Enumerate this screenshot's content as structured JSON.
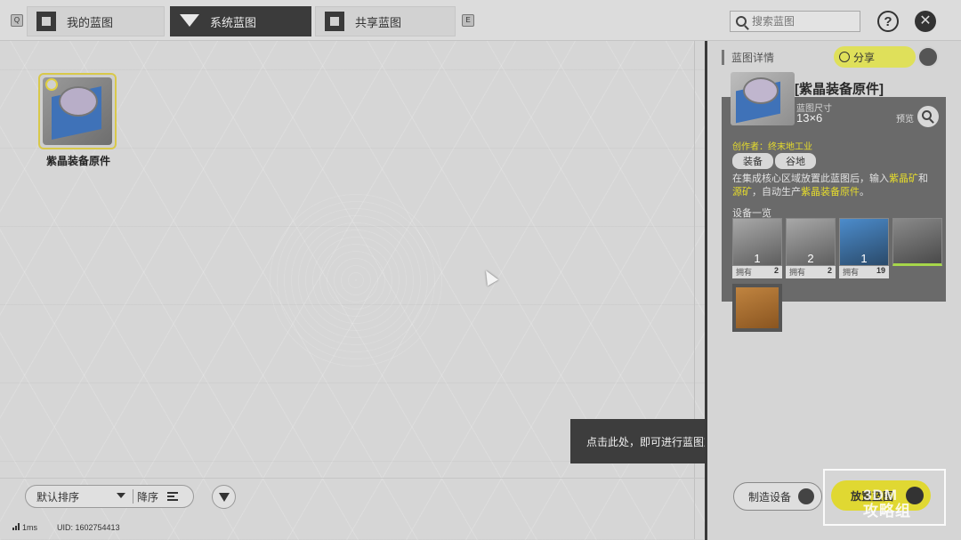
{
  "topbar": {
    "key_left": "Q",
    "key_right": "E",
    "tabs": [
      {
        "label": "我的蓝图",
        "active": false
      },
      {
        "label": "系统蓝图",
        "active": true
      },
      {
        "label": "共享蓝图",
        "active": false
      }
    ],
    "search_placeholder": "搜索蓝图",
    "help": "?",
    "close": "✕"
  },
  "blueprints": [
    {
      "name": "紫晶装备原件"
    }
  ],
  "toolbar": {
    "sort_label": "默认排序",
    "order_label": "降序"
  },
  "status": {
    "ping": "1ms",
    "uid": "UID: 1602754413"
  },
  "tooltip": {
    "text": "点击此处，即可进行蓝图放置。"
  },
  "panel": {
    "header": "蓝图详情",
    "share_label": "分享",
    "title": "[紫晶装备原件]",
    "size_label": "蓝图尺寸",
    "size_value": "13×6",
    "preview_label": "预览",
    "author": "创作者：终末地工业",
    "tags": [
      "装备",
      "谷地"
    ],
    "desc_parts": [
      {
        "text": "在集成核心区域放置此蓝图后，输入",
        "hl": false
      },
      {
        "text": "紫晶矿",
        "hl": true
      },
      {
        "text": "和",
        "hl": false
      },
      {
        "text": "源矿",
        "hl": true
      },
      {
        "text": "，自动生产",
        "hl": false
      },
      {
        "text": "紫晶装备原件",
        "hl": true
      },
      {
        "text": "。",
        "hl": false
      }
    ],
    "equip_title": "设备一览",
    "own_label": "拥有",
    "equipment": [
      {
        "qty": "1",
        "own": "2",
        "style": ""
      },
      {
        "qty": "2",
        "own": "2",
        "style": ""
      },
      {
        "qty": "1",
        "own": "19",
        "style": "eq-blue"
      },
      {
        "qty": "",
        "own": "",
        "style": "eq-green"
      },
      {
        "qty": "",
        "own": "",
        "style": "eq-floor"
      }
    ],
    "craft_label": "制造设备",
    "place_label": "放置蓝图"
  },
  "watermark": "3DM\n攻略组",
  "colors": {
    "accent_yellow": "#e0d832",
    "panel_dark": "#6a6a6a",
    "tab_active": "#3b3b3b"
  }
}
